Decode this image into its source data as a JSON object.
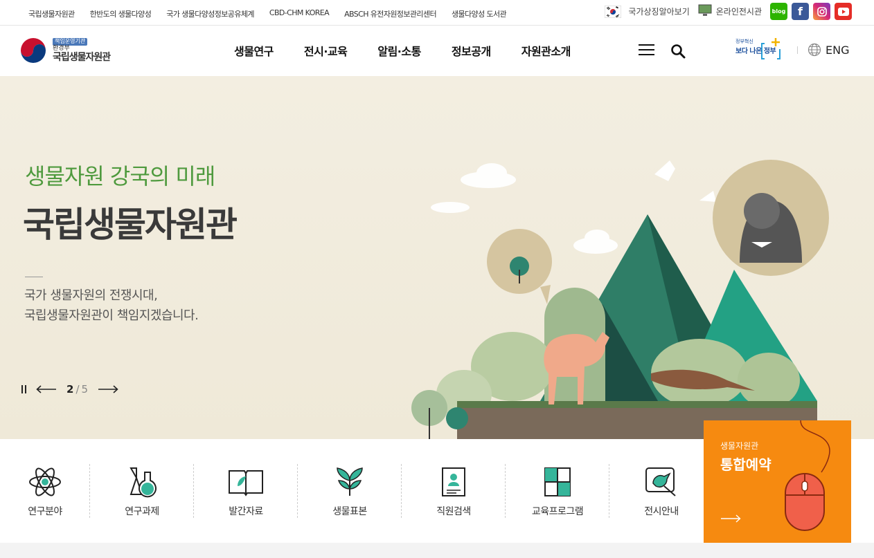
{
  "top_links": [
    "국립생물자원관",
    "한반도의 생물다양성",
    "국가 생물다양성정보공유체계",
    "CBD-CHM KOREA",
    "ABSCH 유전자원정보관리센터",
    "생물다양성 도서관"
  ],
  "top_right": {
    "symbol_label": "국가상징알아보기",
    "online_label": "온라인전시관",
    "sns": [
      "blog",
      "facebook",
      "instagram",
      "youtube"
    ],
    "blog_text": "blog"
  },
  "logo": {
    "badge": "책임운영기관",
    "ministry": "환경부",
    "name": "국립생물자원관"
  },
  "nav": [
    "생물연구",
    "전시·교육",
    "알림·소통",
    "정보공개",
    "자원관소개"
  ],
  "gov_badge": {
    "small": "정부혁신",
    "big": "보다 나은 정부"
  },
  "lang": "ENG",
  "hero": {
    "subtitle": "생물자원 강국의 미래",
    "title": "국립생물자원관",
    "desc1": "국가 생물자원의 전쟁시대,",
    "desc2": "국립생물자원관이 책임지겠습니다.",
    "slide_current": "2",
    "slide_sep": "/",
    "slide_total": "5"
  },
  "quick": [
    {
      "label": "연구분야",
      "icon": "atom-icon"
    },
    {
      "label": "연구과제",
      "icon": "flask-icon"
    },
    {
      "label": "발간자료",
      "icon": "book-icon"
    },
    {
      "label": "생물표본",
      "icon": "leaf-specimen-icon"
    },
    {
      "label": "직원검색",
      "icon": "staff-card-icon"
    },
    {
      "label": "교육프로그램",
      "icon": "puzzle-icon"
    },
    {
      "label": "전시안내",
      "icon": "bird-frame-icon"
    }
  ],
  "reserve": {
    "small": "생물자원관",
    "big": "통합예약"
  },
  "colors": {
    "green": "#4f9a3e",
    "orange": "#f68a10",
    "teal": "#1f8f83"
  }
}
